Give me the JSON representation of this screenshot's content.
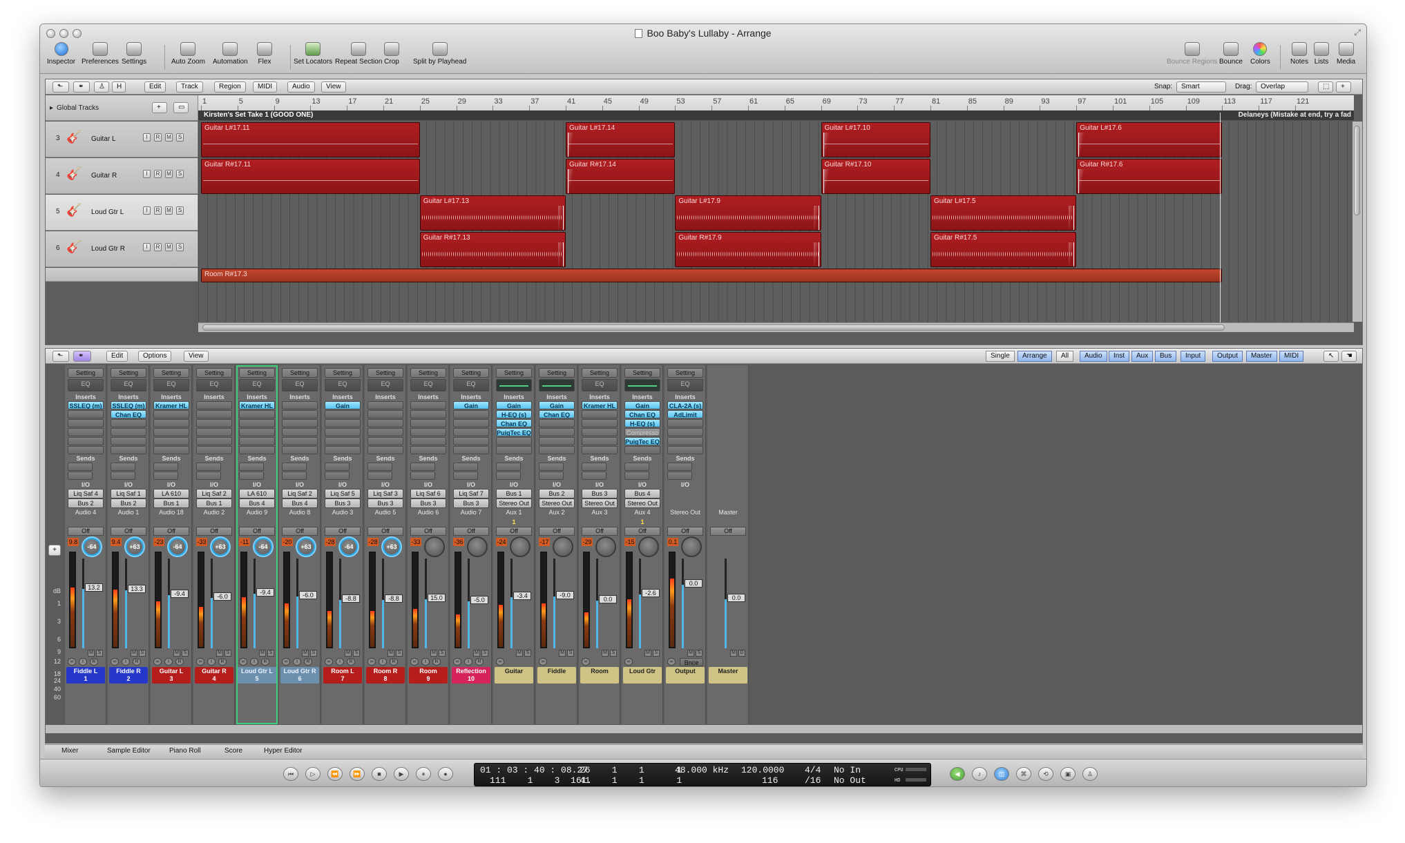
{
  "window": {
    "title": "Boo Baby's Lullaby - Arrange"
  },
  "toolbar": {
    "left": [
      "Inspector",
      "Preferences",
      "Settings",
      "Auto Zoom",
      "Automation",
      "Flex",
      "Set Locators",
      "Repeat Section",
      "Crop",
      "Split by Playhead"
    ],
    "right": [
      "Bounce Regions",
      "Bounce",
      "Colors",
      "Notes",
      "Lists",
      "Media"
    ]
  },
  "arrange": {
    "menus": [
      "Edit",
      "Track",
      "Region",
      "MIDI",
      "Audio",
      "View"
    ],
    "snap_label": "Snap:",
    "snap_value": "Smart",
    "drag_label": "Drag:",
    "drag_value": "Overlap",
    "global_tracks": "Global Tracks",
    "ruler": [
      "1",
      "5",
      "9",
      "13",
      "17",
      "21",
      "25",
      "29",
      "33",
      "37",
      "41",
      "45",
      "49",
      "53",
      "57",
      "61",
      "65",
      "69",
      "73",
      "77",
      "81",
      "85",
      "89",
      "93",
      "97",
      "101",
      "105",
      "109",
      "113",
      "117",
      "121"
    ],
    "marker": "Kirsten's Set Take 1 (GOOD ONE)",
    "marker_right": "Delaneys (Mistake at end, try a fad",
    "tracks": [
      {
        "num": "3",
        "name": "Guitar L"
      },
      {
        "num": "4",
        "name": "Guitar R"
      },
      {
        "num": "5",
        "name": "Loud Gtr L"
      },
      {
        "num": "6",
        "name": "Loud Gtr R"
      }
    ],
    "track_buttons": [
      "I",
      "R",
      "M",
      "S"
    ],
    "regions": [
      {
        "lane": 0,
        "start": 1,
        "end": 25,
        "name": "Guitar L#17.11"
      },
      {
        "lane": 0,
        "start": 41,
        "end": 53,
        "name": "Guitar L#17.14"
      },
      {
        "lane": 0,
        "start": 69,
        "end": 81,
        "name": "Guitar L#17.10"
      },
      {
        "lane": 0,
        "start": 97,
        "end": 113,
        "name": "Guitar L#17.6"
      },
      {
        "lane": 1,
        "start": 1,
        "end": 25,
        "name": "Guitar R#17.11"
      },
      {
        "lane": 1,
        "start": 41,
        "end": 53,
        "name": "Guitar R#17.14"
      },
      {
        "lane": 1,
        "start": 69,
        "end": 81,
        "name": "Guitar R#17.10"
      },
      {
        "lane": 1,
        "start": 97,
        "end": 113,
        "name": "Guitar R#17.6"
      },
      {
        "lane": 2,
        "start": 25,
        "end": 41,
        "name": "Guitar L#17.13"
      },
      {
        "lane": 2,
        "start": 53,
        "end": 69,
        "name": "Guitar L#17.9"
      },
      {
        "lane": 2,
        "start": 81,
        "end": 97,
        "name": "Guitar L#17.5"
      },
      {
        "lane": 3,
        "start": 25,
        "end": 41,
        "name": "Guitar R#17.13"
      },
      {
        "lane": 3,
        "start": 53,
        "end": 69,
        "name": "Guitar R#17.9"
      },
      {
        "lane": 3,
        "start": 81,
        "end": 97,
        "name": "Guitar R#17.5"
      },
      {
        "lane": 4,
        "start": 1,
        "end": 113,
        "name": "Room R#17.3"
      }
    ]
  },
  "mixer": {
    "menus": [
      "Edit",
      "Options",
      "View"
    ],
    "filters": [
      "Single",
      "Arrange",
      "All",
      "Audio",
      "Inst",
      "Aux",
      "Bus",
      "Input",
      "Output",
      "Master",
      "MIDI"
    ],
    "labels": {
      "setting": "Setting",
      "eq": "EQ",
      "inserts": "Inserts",
      "sends": "Sends",
      "io": "I/O",
      "auto": "Off"
    },
    "db_scale": [
      "dB",
      "1",
      "3",
      "6",
      "9",
      "12",
      "18",
      "24",
      "40",
      "60"
    ],
    "strips": [
      {
        "name": "Fiddle L",
        "num": "1",
        "color": "#2638c9",
        "text": "#ffffff",
        "inserts": [
          "SSLEQ (m)"
        ],
        "io_in": "Liq Saf 4",
        "io_out": "Bus 2",
        "out": "Audio 4",
        "peak": "9.8",
        "pan": "-64",
        "fader": "13.2",
        "level": 0.62
      },
      {
        "name": "Fiddle R",
        "num": "2",
        "color": "#2638c9",
        "text": "#ffffff",
        "inserts": [
          "SSLEQ (m)",
          "Chan EQ"
        ],
        "io_in": "Liq Saf 1",
        "io_out": "Bus 2",
        "out": "Audio 1",
        "peak": "9.4",
        "pan": "+63",
        "fader": "13.3",
        "level": 0.6
      },
      {
        "name": "Guitar L",
        "num": "3",
        "color": "#b51d1d",
        "text": "#ffffff",
        "inserts": [
          "Kramer HL"
        ],
        "io_in": "LA 610",
        "io_out": "Bus 1",
        "out": "Audio 18",
        "peak": "-23",
        "pan": "-64",
        "fader": "-9.4",
        "level": 0.48
      },
      {
        "name": "Guitar R",
        "num": "4",
        "color": "#b51d1d",
        "text": "#ffffff",
        "inserts": [],
        "io_in": "Liq Saf 2",
        "io_out": "Bus 1",
        "out": "Audio 2",
        "peak": "-33",
        "pan": "+63",
        "fader": "-6.0",
        "level": 0.42
      },
      {
        "name": "Loud Gtr L",
        "num": "5",
        "color": "#6c8fae",
        "text": "#eaf3ff",
        "inserts": [
          "Kramer HL"
        ],
        "io_in": "LA 610",
        "io_out": "Bus 4",
        "out": "Audio 9",
        "peak": "-11",
        "pan": "-64",
        "fader": "-9.4",
        "level": 0.52,
        "selected": true
      },
      {
        "name": "Loud Gtr R",
        "num": "6",
        "color": "#6c8fae",
        "text": "#eaf3ff",
        "inserts": [],
        "io_in": "Liq Saf 2",
        "io_out": "Bus 4",
        "out": "Audio 8",
        "peak": "-20",
        "pan": "+63",
        "fader": "-6.0",
        "level": 0.46
      },
      {
        "name": "Room L",
        "num": "7",
        "color": "#b51d1d",
        "text": "#ffffff",
        "inserts": [
          "Gain"
        ],
        "io_in": "Liq Saf 5",
        "io_out": "Bus 3",
        "out": "Audio 3",
        "peak": "-28",
        "pan": "-64",
        "fader": "-8.8",
        "level": 0.38
      },
      {
        "name": "Room R",
        "num": "8",
        "color": "#b51d1d",
        "text": "#ffffff",
        "inserts": [],
        "io_in": "Liq Saf 3",
        "io_out": "Bus 3",
        "out": "Audio 5",
        "peak": "-28",
        "pan": "+63",
        "fader": "-8.8",
        "level": 0.38
      },
      {
        "name": "Room",
        "num": "9",
        "color": "#b51d1d",
        "text": "#ffffff",
        "inserts": [],
        "io_in": "Liq Saf 6",
        "io_out": "Bus 3",
        "out": "Audio 6",
        "peak": "-33",
        "pan": "",
        "fader": "15.0",
        "level": 0.4
      },
      {
        "name": "Reflection",
        "num": "10",
        "color": "#d6235a",
        "text": "#ffffff",
        "inserts": [
          "Gain"
        ],
        "io_in": "Liq Saf 7",
        "io_out": "Bus 3",
        "out": "Audio 7",
        "peak": "-36",
        "pan": "",
        "fader": "-5.0",
        "level": 0.34
      },
      {
        "name": "Guitar",
        "num": "",
        "color": "#cfc486",
        "text": "#222222",
        "inserts": [
          "Gain",
          "H-EQ (s)",
          "Chan EQ",
          "PuigTec EQ"
        ],
        "io_in": "Bus 1",
        "io_out": "Stereo Out",
        "out": "Aux 1",
        "badge": "1",
        "peak": "-24",
        "pan": "",
        "fader": "-3.4",
        "level": 0.44,
        "eqcurve": true
      },
      {
        "name": "Fiddle",
        "num": "",
        "color": "#cfc486",
        "text": "#222222",
        "inserts": [
          "Gain",
          "Chan EQ"
        ],
        "io_in": "Bus 2",
        "io_out": "Stereo Out",
        "out": "Aux 2",
        "peak": "-17",
        "pan": "",
        "fader": "-9.0",
        "level": 0.46,
        "eqcurve": true
      },
      {
        "name": "Room",
        "num": "",
        "color": "#cfc486",
        "text": "#222222",
        "inserts": [
          "Kramer HL"
        ],
        "io_in": "Bus 3",
        "io_out": "Stereo Out",
        "out": "Aux 3",
        "peak": "-29",
        "pan": "",
        "fader": "0.0",
        "level": 0.36
      },
      {
        "name": "Loud Gtr",
        "num": "",
        "color": "#cfc486",
        "text": "#222222",
        "inserts": [
          "Gain",
          "Chan EQ",
          "H-EQ (s)",
          "Compresso",
          "PuigTec EQ"
        ],
        "io_in": "Bus 4",
        "io_out": "Stereo Out",
        "out": "Aux 4",
        "badge": "1",
        "peak": "-15",
        "pan": "",
        "fader": "-2.6",
        "level": 0.5,
        "eqcurve": true,
        "bypass": [
          3
        ]
      },
      {
        "name": "Output",
        "num": "",
        "color": "#cfc486",
        "text": "#222222",
        "inserts": [
          "CLA-2A (s)",
          "AdLimit"
        ],
        "io_in": "",
        "io_out": "",
        "out": "Stereo Out",
        "peak": "0.1",
        "pan": "",
        "fader": "0.0",
        "level": 0.72,
        "bnce": "Bnce"
      },
      {
        "name": "Master",
        "num": "",
        "color": "#cfc486",
        "text": "#222222",
        "inserts": null,
        "io_in": "",
        "io_out": "",
        "out": "Master",
        "peak": "",
        "pan": "",
        "fader": "0.0",
        "level": 0,
        "master": true
      }
    ]
  },
  "tabs": [
    "Mixer",
    "Sample Editor",
    "Piano Roll",
    "Score",
    "Hyper Editor"
  ],
  "transport": {
    "smpte": "01 : 03 : 40 : 08.27",
    "bars": "111    1    3  161.",
    "loc1": "26    1    1      1",
    "loc2": "41    1    1      1",
    "rate": "48.000 kHz",
    "tempo": "120.0000",
    "tempo2": "116",
    "sig": "4/4",
    "div": "/16",
    "in": "No In",
    "out": "No Out",
    "cpu": "CPU",
    "hd": "HD"
  }
}
